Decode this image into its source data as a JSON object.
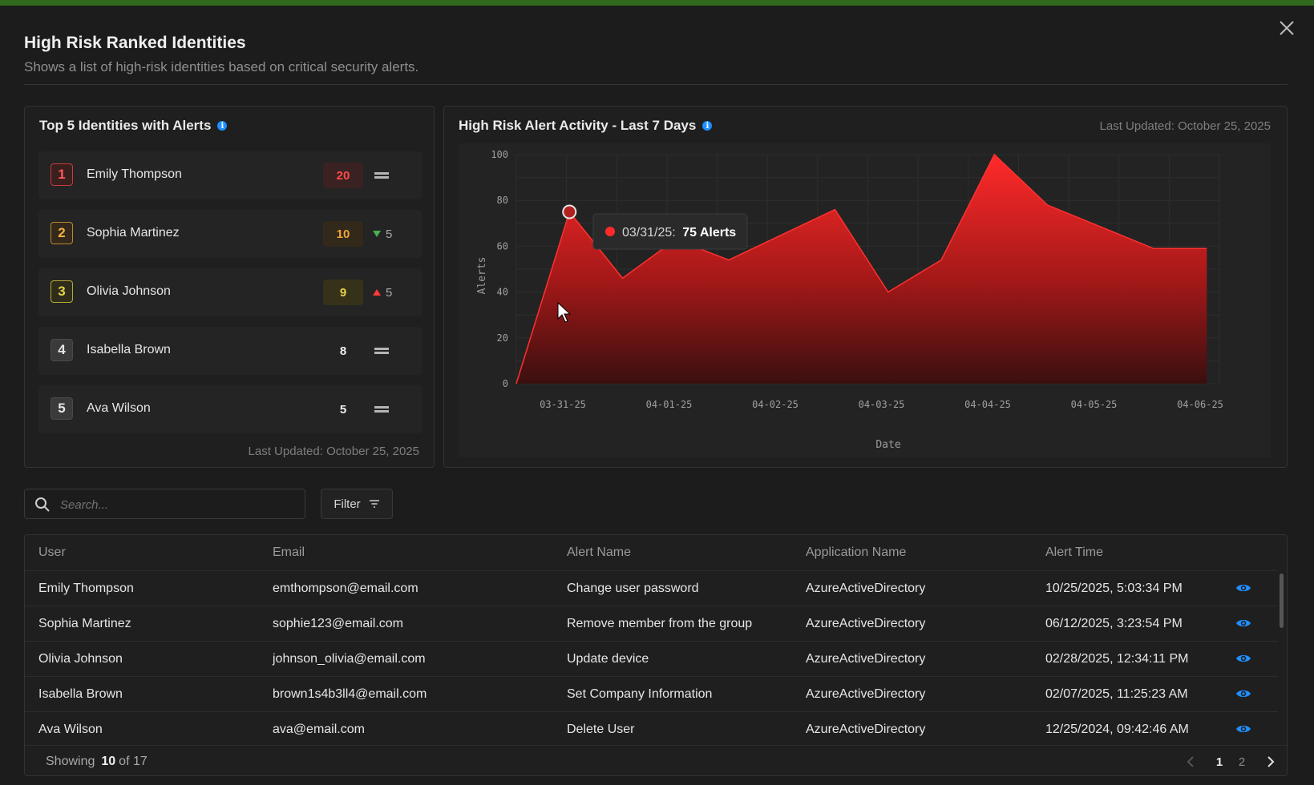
{
  "colors": {
    "accent_green": "#2f6a1e",
    "alert_red": "#ff2a2a",
    "info_blue": "#1f8fff"
  },
  "header": {
    "title": "High Risk Ranked Identities",
    "subtitle": "Shows a list of high-risk identities based on critical security alerts."
  },
  "top_identities": {
    "title": "Top 5 Identities with Alerts",
    "last_updated": "Last Updated:  October 25, 2025",
    "items": [
      {
        "rank": "1",
        "name": "Emily Thompson",
        "count": "20",
        "trend": "same",
        "delta": ""
      },
      {
        "rank": "2",
        "name": "Sophia Martinez",
        "count": "10",
        "trend": "down",
        "delta": "5"
      },
      {
        "rank": "3",
        "name": "Olivia Johnson",
        "count": "9",
        "trend": "up",
        "delta": "5"
      },
      {
        "rank": "4",
        "name": "Isabella Brown",
        "count": "8",
        "trend": "same",
        "delta": ""
      },
      {
        "rank": "5",
        "name": "Ava Wilson",
        "count": "5",
        "trend": "same",
        "delta": ""
      }
    ]
  },
  "activity": {
    "title": "High Risk Alert Activity - Last 7 Days",
    "last_updated": "Last Updated:  October 25, 2025",
    "tooltip": {
      "date": "03/31/25:",
      "value": "75 Alerts"
    }
  },
  "chart_data": {
    "type": "area",
    "xlabel": "Date",
    "ylabel": "Alerts",
    "ylim": [
      0,
      100
    ],
    "yticks": [
      0,
      20,
      40,
      60,
      80,
      100
    ],
    "categories": [
      "03-31-25",
      "04-01-25",
      "04-02-25",
      "04-03-25",
      "04-04-25",
      "04-05-25",
      "04-06-25"
    ],
    "x": [
      0,
      0.5,
      1,
      1.5,
      2,
      3,
      3.5,
      4,
      4.5,
      5,
      6,
      6.5
    ],
    "values": [
      0,
      75,
      46,
      63,
      54,
      76,
      40,
      54,
      100,
      78,
      59,
      59
    ],
    "highlight_index": 1,
    "grid": true,
    "legend": "none"
  },
  "search": {
    "placeholder": "Search..."
  },
  "filter": {
    "label": "Filter"
  },
  "table": {
    "columns": [
      "User",
      "Email",
      "Alert Name",
      "Application Name",
      "Alert Time"
    ],
    "rows": [
      [
        "Emily Thompson",
        "emthompson@email.com",
        "Change user password",
        "AzureActiveDirectory",
        "10/25/2025, 5:03:34 PM"
      ],
      [
        "Sophia Martinez",
        "sophie123@email.com",
        "Remove member from the group",
        "AzureActiveDirectory",
        "06/12/2025, 3:23:54 PM"
      ],
      [
        "Olivia Johnson",
        "johnson_olivia@email.com",
        "Update device",
        "AzureActiveDirectory",
        "02/28/2025, 12:34:11 PM"
      ],
      [
        "Isabella Brown",
        "brown1s4b3ll4@email.com",
        "Set Company Information",
        "AzureActiveDirectory",
        "02/07/2025, 11:25:23 AM"
      ],
      [
        "Ava Wilson",
        "ava@email.com",
        "Delete User",
        "AzureActiveDirectory",
        "12/25/2024, 09:42:46 AM"
      ]
    ]
  },
  "footer": {
    "showing_label": "Showing",
    "showing_count": "10",
    "showing_total": "of 17",
    "pages": [
      "1",
      "2"
    ],
    "current_page": "1"
  }
}
